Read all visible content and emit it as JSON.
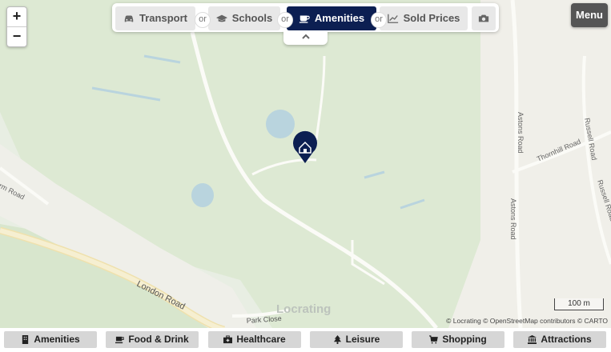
{
  "toolbar": {
    "transport": "Transport",
    "schools": "Schools",
    "amenities": "Amenities",
    "sold_prices": "Sold Prices",
    "or": "or"
  },
  "menu_label": "Menu",
  "zoom": {
    "plus": "+",
    "minus": "−"
  },
  "map": {
    "roads": {
      "london_road": "London Road",
      "park_close": "Park Close",
      "astons_road_1": "Astons Road",
      "astons_road_2": "Astons Road",
      "thornhill_road": "Thornhill Road",
      "russell_road_1": "Russell Road",
      "russell_road_2": "Russell Road",
      "partial_road": "rm Road"
    },
    "watermark": "Locrating",
    "scale": "100 m",
    "attribution": {
      "locrating": "© Locrating",
      "osm": "© OpenStreetMap contributors",
      "carto": "© CARTO"
    },
    "colors": {
      "park": "#dfead6",
      "road": "#f7f6f1",
      "water": "#b6d3df",
      "marker": "#0c1f52"
    }
  },
  "categories": [
    "Amenities",
    "Food & Drink",
    "Healthcare",
    "Leisure",
    "Shopping",
    "Attractions"
  ]
}
